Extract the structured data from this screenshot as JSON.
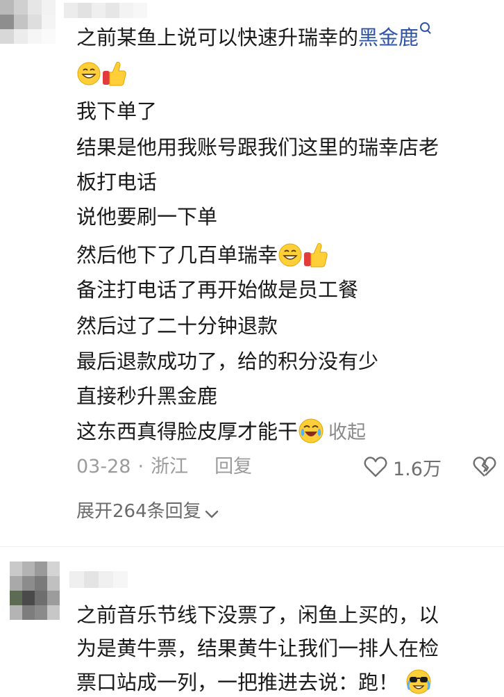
{
  "comment1": {
    "lines": {
      "l1_text": "之前某鱼上说可以快速升瑞幸的",
      "l1_link": "黑金鹿",
      "l3": "我下单了",
      "l4": "结果是他用我账号跟我们这里的瑞幸店老",
      "l5": "板打电话",
      "l6": "说他要刷一下单",
      "l7": "然后他下了几百单瑞幸",
      "l8": "备注打电话了再开始做是员工餐",
      "l9": "然后过了二十分钟退款",
      "l10": "最后退款成功了，给的积分没有少",
      "l11": "直接秒升黑金鹿",
      "l12": "这东西真得脸皮厚才能干"
    },
    "collapse_label": "收起",
    "date": "03-28",
    "dot": "·",
    "location": "浙江",
    "reply_label": "回复",
    "like_count": "1.6万",
    "expand_label": "展开264条回复"
  },
  "comment2": {
    "lines": [
      "之前音乐节线下没票了，闲鱼上买的，以",
      "为是黄牛票，结果黄牛让我们一排人在检",
      "票口站成一列，一把推进去说：跑！"
    ]
  },
  "colors": {
    "link": "#2f54a7",
    "text": "#1a1a1a",
    "meta": "#9b9b9b"
  },
  "icons": [
    "grin-emoji",
    "thumbs-up-emoji",
    "search-icon",
    "crying-laugh-emoji",
    "heart-icon",
    "broken-heart-icon",
    "chevron-down-icon",
    "sunglasses-emoji"
  ]
}
